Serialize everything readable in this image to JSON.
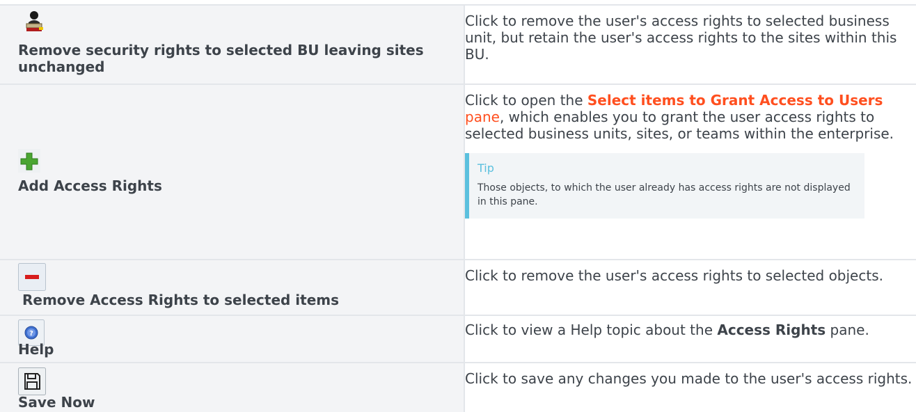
{
  "rows": [
    {
      "label": "Remove security rights to selected BU leaving sites unchanged",
      "icon": "remove-security-icon",
      "desc": "Click to remove the user's access rights to selected business unit, but retain the user's access rights to the sites within this BU."
    },
    {
      "label": "Add Access Rights",
      "icon": "plus-icon",
      "desc_pre": "Click to open the ",
      "desc_link_bold": "Select items to Grant Access to Users",
      "desc_link_rest": " pane",
      "desc_post": ", which enables you to grant the user access rights to selected business units, sites, or teams within the enterprise.",
      "tip_title": "Tip",
      "tip_text": "Those objects, to which the user already has access rights are not displayed in this pane."
    },
    {
      "label": "Remove Access Rights to selected items",
      "icon": "minus-icon",
      "desc": "Click to remove the user's access rights to selected objects."
    },
    {
      "label": "Help",
      "icon": "help-icon",
      "desc_pre": "Click to view a Help topic about the ",
      "desc_bold": "Access Rights",
      "desc_post": " pane."
    },
    {
      "label": "Save Now",
      "icon": "save-icon",
      "desc": "Click to save any changes you made to the user's access rights."
    }
  ]
}
